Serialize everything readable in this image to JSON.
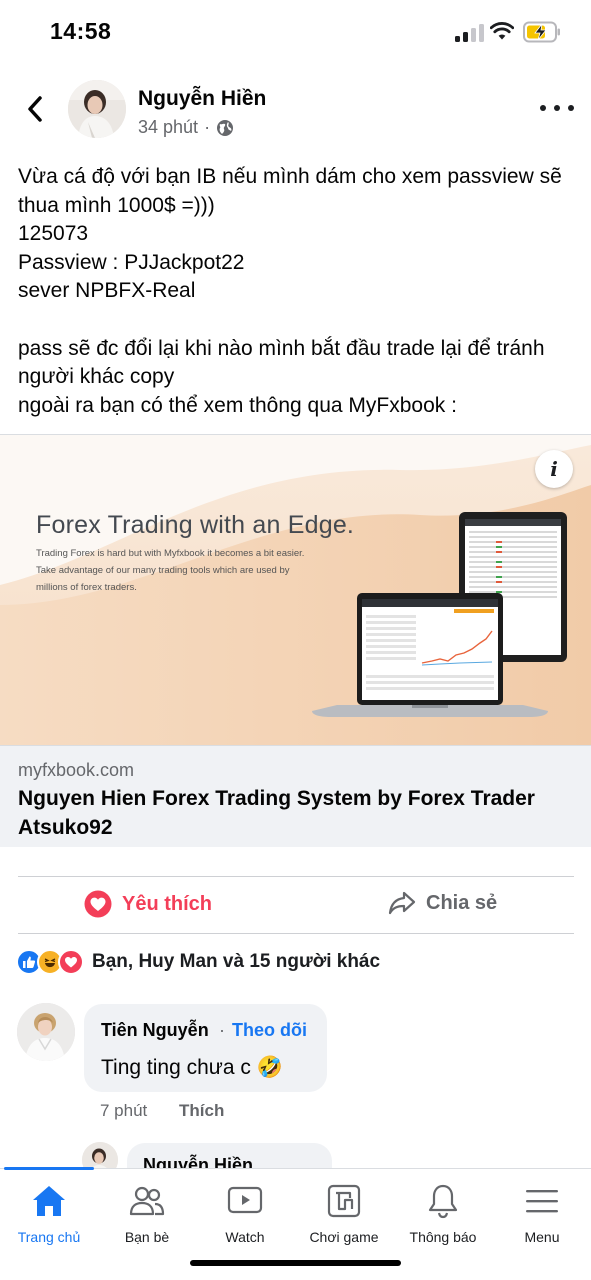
{
  "status_bar": {
    "time": "14:58",
    "battery_color": "#f5c400"
  },
  "post": {
    "author": "Nguyễn Hiền",
    "time": "34 phút",
    "separator": "·",
    "text_lines": [
      "Vừa cá độ với bạn IB nếu mình dám cho xem passview sẽ",
      "thua mình 1000$ =)))",
      "125073",
      "Passview : PJJackpot22",
      "sever NPBFX-Real",
      "",
      "pass sẽ đc đổi lại khi nào mình bắt đầu trade lại để tránh",
      "người khác copy",
      "ngoài ra bạn có thể xem thông qua MyFxbook :"
    ]
  },
  "link_preview": {
    "hero_title": "Forex Trading with an Edge.",
    "hero_sub": [
      "Trading Forex is hard but with Myfxbook it becomes a bit easier.",
      "Take advantage of our many trading tools which are used by",
      "millions of forex traders."
    ],
    "info_glyph": "i",
    "domain": "myfxbook.com",
    "title": "Nguyen Hien Forex Trading System by Forex Trader Atsuko92"
  },
  "actions": {
    "like_label": "Yêu thích",
    "share_label": "Chia sẻ",
    "like_color": "#f33e58"
  },
  "reactions": {
    "icons": [
      "like-icon",
      "haha-icon",
      "love-icon"
    ],
    "summary": "Bạn, Huy Man và 15 người khác"
  },
  "comments": [
    {
      "author": "Tiên Nguyễn",
      "separator": "·",
      "follow_label": "Theo dõi",
      "text": "Ting ting chưa c 🤣",
      "time": "7 phút",
      "like_label": "Thích"
    }
  ],
  "reply_preview": {
    "author": "Nguyễn Hiền"
  },
  "bottom_nav": [
    {
      "label": "Trang chủ",
      "icon": "home-icon",
      "active": true
    },
    {
      "label": "Bạn bè",
      "icon": "friends-icon",
      "active": false
    },
    {
      "label": "Watch",
      "icon": "watch-icon",
      "active": false
    },
    {
      "label": "Chơi game",
      "icon": "gaming-icon",
      "active": false
    },
    {
      "label": "Thông báo",
      "icon": "bell-icon",
      "active": false
    },
    {
      "label": "Menu",
      "icon": "menu-icon",
      "active": false
    }
  ],
  "colors": {
    "accent": "#1877f2",
    "secondary_text": "#65676b"
  }
}
